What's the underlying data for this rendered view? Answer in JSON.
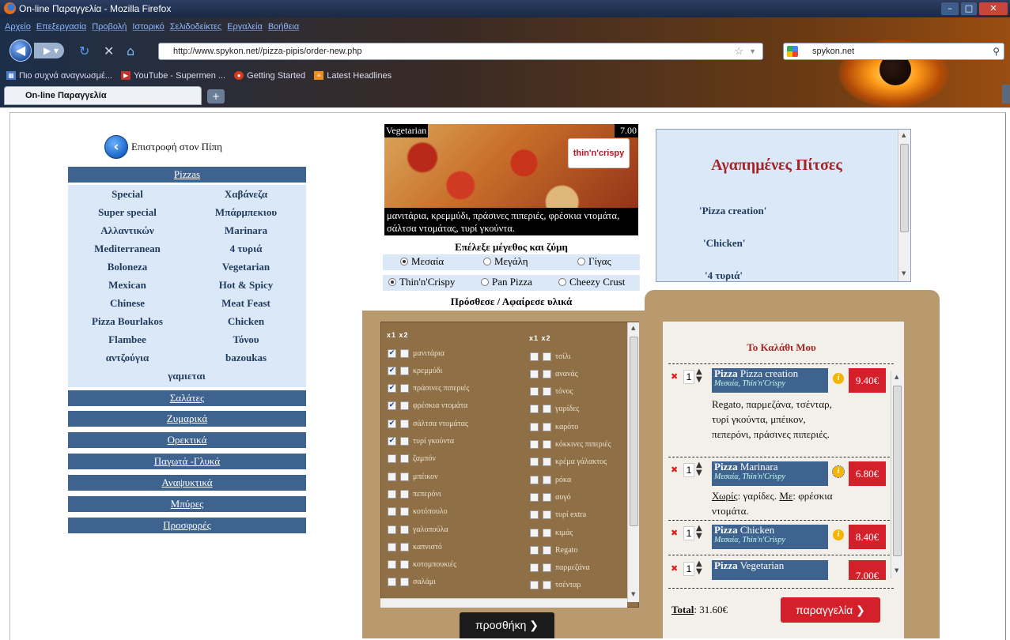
{
  "browser": {
    "window_title": "On-line Παραγγελία - Mozilla Firefox",
    "menu": [
      "Αρχείο",
      "Επεξεργασία",
      "Προβολή",
      "Ιστορικό",
      "Σελιδοδείκτες",
      "Εργαλεία",
      "Βοήθεια"
    ],
    "url": "http://www.spykon.net//pizza-pipis/order-new.php",
    "search_value": "spykon.net",
    "bookmarks": [
      "Πιο συχνά αναγνωσμέ...",
      "YouTube - Supermen ...",
      "Getting Started",
      "Latest Headlines"
    ],
    "tab_title": "On-line Παραγγελία",
    "new_tab": "+"
  },
  "sidebar": {
    "back_label": "Επιστροφή στον Πίπη",
    "categories": [
      "Pizzas",
      "Σαλάτες",
      "Ζυμαρικά",
      "Ορεκτικά",
      "Παγωτά -Γλυκά",
      "Αναψυκτικά",
      "Μπύρες",
      "Προσφορές"
    ],
    "pizzas": [
      "Special",
      "Χαβάνεζα",
      "Super special",
      "Μπάρμπεκιου",
      "Αλλαντικών",
      "Marinara",
      "Mediterranean",
      "4 τυριά",
      "Boloneza",
      "Vegetarian",
      "Mexican",
      "Hot & Spicy",
      "Chinese",
      "Meat Feast",
      "Pizza Bourlakos",
      "Chicken",
      "Flambee",
      "Τόνου",
      "αντζούγια",
      "bazoukas",
      "γαμιεται"
    ]
  },
  "pizza_view": {
    "name": "Vegetarian",
    "price": "7.00",
    "logo_text": "thin'n'crispy",
    "description": "μανιτάρια, κρεμμύδι, πράσινες πιπεριές, φρέσκια ντομάτα, σάλτσα ντομάτας, τυρί γκούντα.",
    "size_heading": "Επέλεξε μέγεθος και ζύμη",
    "sizes": [
      "Μεσαία",
      "Μεγάλη",
      "Γίγας"
    ],
    "selected_size": "Μεσαία",
    "doughs": [
      "Thin'n'Crispy",
      "Pan Pizza",
      "Cheezy Crust"
    ],
    "selected_dough": "Thin'n'Crispy",
    "ingredients_heading": "Πρόσθεσε / Αφαίρεσε υλικά",
    "col_header": "x1 x2",
    "ingredients_left": [
      {
        "name": "μανιτάρια",
        "x1": true
      },
      {
        "name": "κρεμμύδι",
        "x1": true
      },
      {
        "name": "πράσινες πιπεριές",
        "x1": true
      },
      {
        "name": "φρέσκια ντομάτα",
        "x1": true
      },
      {
        "name": "σάλτσα ντομάτας",
        "x1": true
      },
      {
        "name": "τυρί γκούντα",
        "x1": true
      },
      {
        "name": "ζαμπόν",
        "x1": false
      },
      {
        "name": "μπέικον",
        "x1": false
      },
      {
        "name": "πεπερόνι",
        "x1": false
      },
      {
        "name": "κοτόπουλο",
        "x1": false
      },
      {
        "name": "γαλοπούλα",
        "x1": false
      },
      {
        "name": "καπνιστό",
        "x1": false
      },
      {
        "name": "κοτομπουκιές",
        "x1": false
      },
      {
        "name": "σαλάμι",
        "x1": false
      }
    ],
    "ingredients_right": [
      {
        "name": "τσίλι",
        "x1": false
      },
      {
        "name": "ανανάς",
        "x1": false
      },
      {
        "name": "τόνος",
        "x1": false
      },
      {
        "name": "γαρίδες",
        "x1": false
      },
      {
        "name": "καρότο",
        "x1": false
      },
      {
        "name": "κόκκινες πιπεριές",
        "x1": false
      },
      {
        "name": "κρέμα γάλακτος",
        "x1": false
      },
      {
        "name": "ρόκα",
        "x1": false
      },
      {
        "name": "αυγό",
        "x1": false
      },
      {
        "name": "τυρί extra",
        "x1": false
      },
      {
        "name": "κιμάς",
        "x1": false
      },
      {
        "name": "Regato",
        "x1": false
      },
      {
        "name": "παρμεζάνα",
        "x1": false
      },
      {
        "name": "τσένταρ",
        "x1": false
      }
    ],
    "add_button": "προσθήκη"
  },
  "favorites": {
    "title": "Αγαπημένες Πίτσες",
    "items": [
      "'Pizza creation'",
      "'Chicken'",
      "'4 τυριά'"
    ]
  },
  "cart": {
    "title": "Το Καλάθι Μου",
    "items": [
      {
        "prefix": "Pizza",
        "name": "Pizza creation",
        "qty": "1",
        "options": "Μεσαία, Thin'n'Crispy",
        "price": "9.40€",
        "desc": "Regato, παρμεζάνα, τσένταρ, τυρί γκούντα, μπέικον, πεπερόνι, πράσινες πιπεριές."
      },
      {
        "prefix": "Pizza",
        "name": "Marinara",
        "qty": "1",
        "options": "Μεσαία, Thin'n'Crispy",
        "price": "6.80€",
        "without_label": "Χωρίς",
        "without": "γαρίδες.",
        "with_label": "Με",
        "with": "φρέσκια ντομάτα."
      },
      {
        "prefix": "Pizza",
        "name": "Chicken",
        "qty": "1",
        "options": "Μεσαία, Thin'n'Crispy",
        "price": "8.40€"
      },
      {
        "prefix": "Pizza",
        "name": "Vegetarian",
        "qty": "1",
        "price": "7.00€"
      }
    ],
    "total_label": "Total",
    "total_value": "31.60€",
    "order_button": "παραγγελία"
  },
  "colors": {
    "nav_blue": "#3f638f",
    "light_blue": "#dbe8f7",
    "accent_red": "#d4202a",
    "title_red": "#a32525"
  }
}
